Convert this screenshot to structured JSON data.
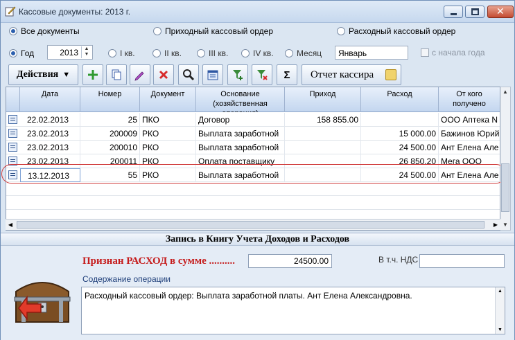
{
  "window": {
    "title": "Кассовые документы: 2013 г.",
    "controls": [
      "minimize",
      "maximize",
      "close"
    ]
  },
  "doc_filter": {
    "all": "Все документы",
    "income": "Приходный кассовый ордер",
    "expense": "Расходный кассовый ордер",
    "selected": "all"
  },
  "period_filter": {
    "year_label": "Год",
    "year_value": "2013",
    "q1": "I кв.",
    "q2": "II кв.",
    "q3": "III кв.",
    "q4": "IV кв.",
    "month_label": "Месяц",
    "month_value": "Январь",
    "from_year_start": "с начала года",
    "selected": "year"
  },
  "toolbar": {
    "actions_label": "Действия",
    "report_label": "Отчет кассира",
    "icons": [
      "add-icon",
      "copy-icon",
      "edit-icon",
      "delete-icon",
      "search-icon",
      "calendar-icon",
      "filter-add-icon",
      "filter-remove-icon",
      "sum-icon"
    ],
    "sum_glyph": "Σ"
  },
  "grid": {
    "columns": [
      "Дата",
      "Номер",
      "Документ",
      "Основание (хозяйственная операция)",
      "Приход",
      "Расход",
      "От кого получено"
    ],
    "rows": [
      {
        "date": "22.02.2013",
        "number": "25",
        "doc": "ПКО",
        "basis": "Договор",
        "income": "158 855.00",
        "expense": "",
        "from": "ООО Аптека N"
      },
      {
        "date": "23.02.2013",
        "number": "200009",
        "doc": "РКО",
        "basis": "Выплата  заработной",
        "income": "",
        "expense": "15 000.00",
        "from": "Бажинов Юрий"
      },
      {
        "date": "23.02.2013",
        "number": "200010",
        "doc": "РКО",
        "basis": "Выплата  заработной",
        "income": "",
        "expense": "24 500.00",
        "from": "Ант Елена Але"
      },
      {
        "date": "23.02.2013",
        "number": "200011",
        "doc": "РКО",
        "basis": "Оплата поставщику",
        "income": "",
        "expense": "26 850.20",
        "from": "Мега ООО"
      },
      {
        "date": "13.12.2013",
        "number": "55",
        "doc": "РКО",
        "basis": "Выплата  заработной",
        "income": "",
        "expense": "24 500.00",
        "from": "Ант Елена Але"
      }
    ]
  },
  "ledger": {
    "title": "Запись в Книгу Учета Доходов и Расходов",
    "expense_label": "Признан РАСХОД в сумме ..........",
    "expense_sum": "24500.00",
    "vat_label": "В т.ч. НДС",
    "vat_value": "",
    "content_label": "Содержание операции",
    "content_text": "Расходный кассовый ордер: Выплата  заработной платы. Ант Елена Александровна."
  },
  "colors": {
    "accent_red": "#c51b1b",
    "header_blue": "#c3d6ef",
    "selection_oval": "#d03a3a"
  }
}
